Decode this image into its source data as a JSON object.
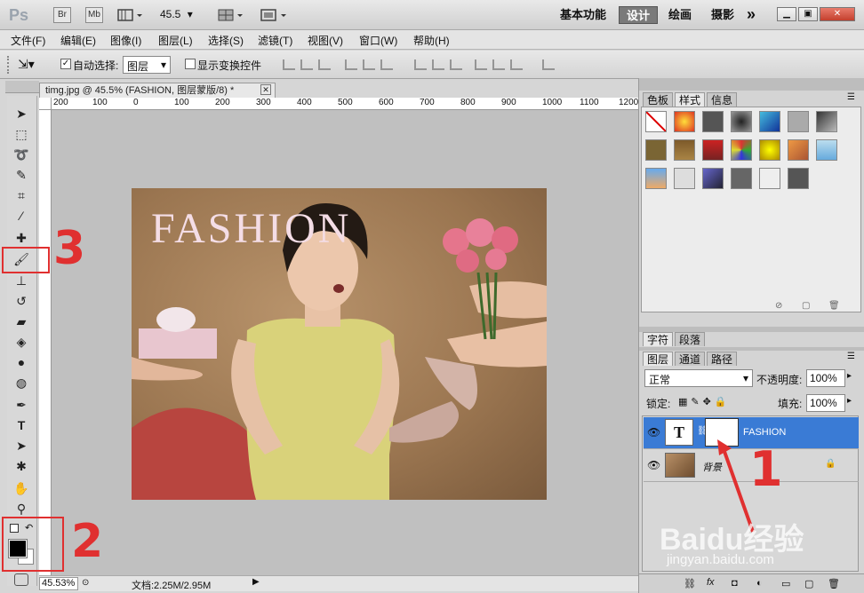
{
  "app": {
    "logo": "Ps",
    "bridge_btn": "Br",
    "minibridge_btn": "Mb",
    "zoom_value": "45.5",
    "workspaces": [
      "基本功能",
      "设计",
      "绘画",
      "摄影"
    ],
    "active_workspace": "设计",
    "more": "»"
  },
  "menu": [
    "文件(F)",
    "编辑(E)",
    "图像(I)",
    "图层(L)",
    "选择(S)",
    "滤镜(T)",
    "视图(V)",
    "窗口(W)",
    "帮助(H)"
  ],
  "options": {
    "auto_select_label": "自动选择:",
    "auto_select_value": "图层",
    "show_transform_label": "显示变换控件"
  },
  "document": {
    "tab_title": "timg.jpg @ 45.5% (FASHION, 图层蒙版/8) *",
    "ruler_ticks": [
      "200",
      "100",
      "0",
      "100",
      "200",
      "300",
      "400",
      "500",
      "600",
      "700",
      "800",
      "900",
      "1000",
      "1100",
      "1200"
    ],
    "photo_text": "FASHION",
    "zoom_status": "45.53%",
    "doc_info": "文档:2.25M/2.95M"
  },
  "panels": {
    "top_tabs": [
      "色板",
      "样式",
      "信息"
    ],
    "active_top_tab": "样式",
    "char_tabs": [
      "字符",
      "段落"
    ],
    "layer_tabs": [
      "图层",
      "通道",
      "路径"
    ],
    "active_layer_tab": "图层",
    "blend_mode": "正常",
    "opacity_label": "不透明度:",
    "opacity_value": "100%",
    "lock_label": "锁定:",
    "fill_label": "填充:",
    "fill_value": "100%",
    "layers": [
      {
        "name": "FASHION",
        "selected": true
      },
      {
        "name": "背景",
        "selected": false
      }
    ]
  },
  "annotations": {
    "n1": "1",
    "n2": "2",
    "n3": "3"
  },
  "watermark": {
    "brand": "Baidu经验",
    "url": "jingyan.baidu.com"
  },
  "colors": {
    "selected_layer": "#3a7bd5",
    "annotation_red": "#e03030",
    "canvas_bg": "#c0c0c0"
  }
}
